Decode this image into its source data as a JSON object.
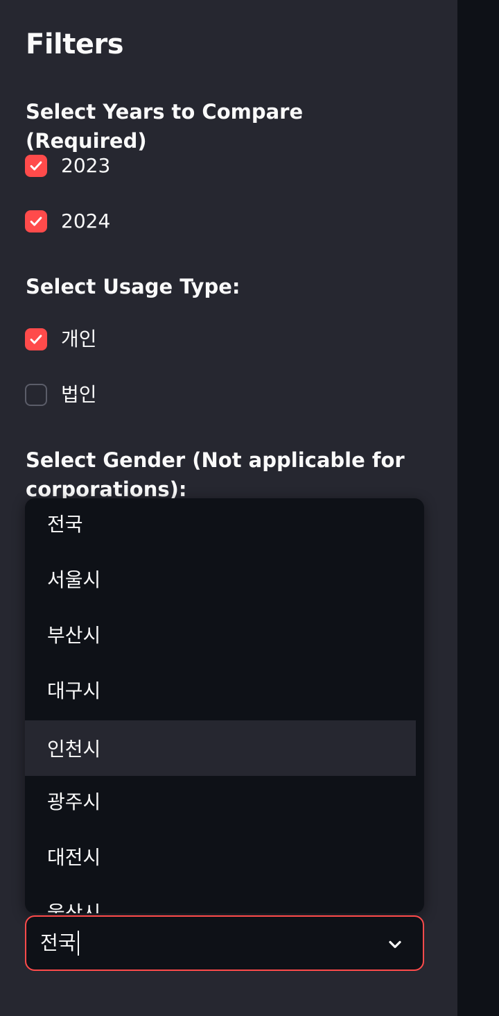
{
  "sidebar": {
    "title": "Filters",
    "years": {
      "label": "Select Years to Compare (Required)",
      "options": [
        {
          "label": "2023",
          "checked": true
        },
        {
          "label": "2024",
          "checked": true
        }
      ]
    },
    "usage": {
      "label": "Select Usage Type:",
      "options": [
        {
          "label": "개인",
          "checked": true
        },
        {
          "label": "법인",
          "checked": false
        }
      ]
    },
    "gender": {
      "label": "Select Gender (Not applicable for corporations):"
    },
    "region": {
      "value": "전국",
      "highlighted_option": "인천시",
      "options": [
        "전국",
        "서울시",
        "부산시",
        "대구시",
        "인천시",
        "광주시",
        "대전시",
        "울산시"
      ]
    }
  },
  "colors": {
    "accent": "#ff4b4b",
    "sidebar_bg": "#262730",
    "main_bg": "#0e1117",
    "text": "#fafafa"
  },
  "icons": {
    "check": "check-icon",
    "chevron": "chevron-down-icon"
  }
}
